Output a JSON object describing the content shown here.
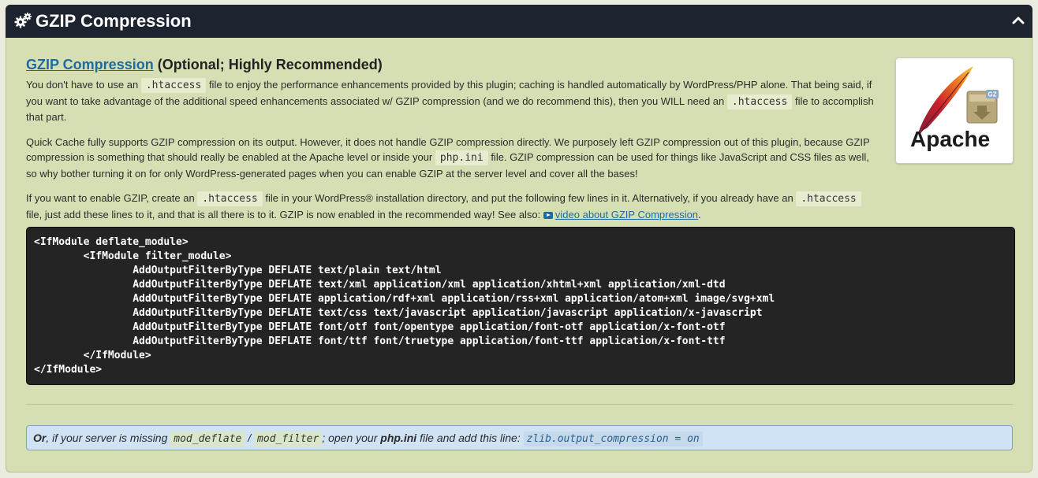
{
  "header": {
    "title": "GZIP Compression",
    "icon": "gears-icon",
    "collapse_icon": "chevron-up-icon"
  },
  "section": {
    "heading_link": "GZIP Compression",
    "heading_suffix": "(Optional; Highly Recommended)",
    "p1": {
      "t1": "You don't have to use an",
      "code1": ".htaccess",
      "t2": "file to enjoy the performance enhancements provided by this plugin; caching is handled automatically by WordPress/PHP alone. That being said, if you want to take advantage of the additional speed enhancements associated w/ GZIP compression (and we do recommend this), then you WILL need an",
      "code2": ".htaccess",
      "t3": "file to accomplish that part."
    },
    "p2": {
      "t1": "Quick Cache fully supports GZIP compression on its output. However, it does not handle GZIP compression directly. We purposely left GZIP compression out of this plugin, because GZIP compression is something that should really be enabled at the Apache level or inside your",
      "code1": "php.ini",
      "t2": "file. GZIP compression can be used for things like JavaScript and CSS files as well, so why bother turning it on for only WordPress-generated pages when you can enable GZIP at the server level and cover all the bases!"
    },
    "p3": {
      "t1": "If you want to enable GZIP, create an",
      "code1": ".htaccess",
      "t2": "file in your WordPress® installation directory, and put the following few lines in it. Alternatively, if you already have an",
      "code2": ".htaccess",
      "t3": "file, just add these lines to it, and that is all there is to it. GZIP is now enabled in the recommended way! See also:",
      "link": "video about GZIP Compression",
      "t4": "."
    }
  },
  "logo": {
    "text": "Apache",
    "badge": "GZ"
  },
  "code_block": "<IfModule deflate_module>\n\t<IfModule filter_module>\n\t\tAddOutputFilterByType DEFLATE text/plain text/html\n\t\tAddOutputFilterByType DEFLATE text/xml application/xml application/xhtml+xml application/xml-dtd\n\t\tAddOutputFilterByType DEFLATE application/rdf+xml application/rss+xml application/atom+xml image/svg+xml\n\t\tAddOutputFilterByType DEFLATE text/css text/javascript application/javascript application/x-javascript\n\t\tAddOutputFilterByType DEFLATE font/otf font/opentype application/font-otf application/x-font-otf\n\t\tAddOutputFilterByType DEFLATE font/ttf font/truetype application/font-ttf application/x-font-ttf\n\t</IfModule>\n</IfModule>",
  "note": {
    "or": "Or",
    "t1": ", if your server is missing",
    "code1": "mod_deflate",
    "slash": "/",
    "code2": "mod_filter",
    "t2": "; open your",
    "bold": "php.ini",
    "t3": "file and add this line:",
    "code3": "zlib.output_compression = on"
  }
}
